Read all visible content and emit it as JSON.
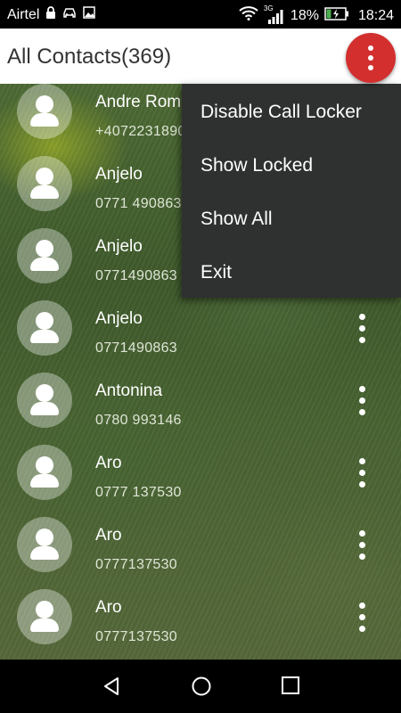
{
  "status_bar": {
    "carrier": "Airtel",
    "network": "3G",
    "battery": "18%",
    "time": "18:24",
    "icons": [
      "lock-icon",
      "car-icon",
      "image-icon",
      "wifi-icon",
      "signal-icon",
      "battery-charging-icon"
    ]
  },
  "app_bar": {
    "title": "All Contacts(369)",
    "overflow_icon": "more-vert-icon",
    "accent": "#d32f2f"
  },
  "menu": {
    "items": [
      {
        "label": "Disable Call Locker"
      },
      {
        "label": "Show Locked"
      },
      {
        "label": "Show All"
      },
      {
        "label": "Exit"
      }
    ]
  },
  "contacts": [
    {
      "name": "Andre Romeo",
      "phone": "+40722318900"
    },
    {
      "name": "Anjelo",
      "phone": "0771 490863"
    },
    {
      "name": "Anjelo",
      "phone": "0771490863"
    },
    {
      "name": "Anjelo",
      "phone": "0771490863"
    },
    {
      "name": "Antonina",
      "phone": "0780 993146"
    },
    {
      "name": "Aro",
      "phone": "0777 137530"
    },
    {
      "name": "Aro",
      "phone": "0777137530"
    },
    {
      "name": "Aro",
      "phone": "0777137530"
    }
  ],
  "nav_bar": {
    "icons": [
      "back-icon",
      "home-icon",
      "recents-icon"
    ]
  }
}
